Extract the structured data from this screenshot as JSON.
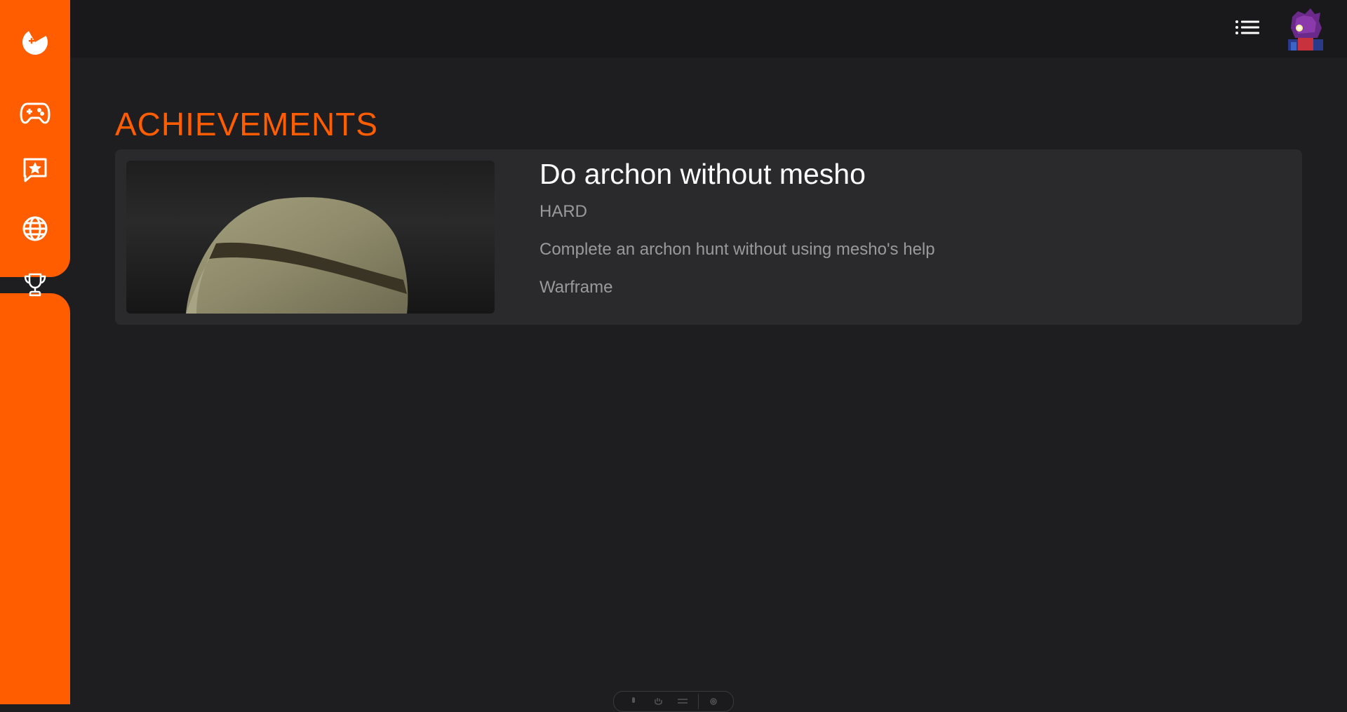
{
  "colors": {
    "accent": "#ff5d00",
    "background": "#1e1e20",
    "topbar": "#19191b",
    "card": "#2a2a2c",
    "muted_text": "#9a9a9a"
  },
  "sidebar": {
    "items": [
      {
        "name": "logo",
        "icon": "pacman-gamepad-icon"
      },
      {
        "name": "games",
        "icon": "gamepad-icon"
      },
      {
        "name": "reviews",
        "icon": "star-message-icon"
      },
      {
        "name": "community",
        "icon": "globe-icon"
      },
      {
        "name": "achievements",
        "icon": "trophy-icon",
        "active": true
      }
    ]
  },
  "topbar": {
    "menu_icon": "list-icon",
    "avatar_icon": "user-avatar"
  },
  "page": {
    "title": "ACHIEVEMENTS"
  },
  "achievements": [
    {
      "title": "Do archon without mesho",
      "difficulty": "HARD",
      "description": "Complete an archon hunt without using mesho's help",
      "game": "Warframe",
      "image": "helmet-thumbnail"
    }
  ],
  "dock": {
    "icons": [
      "microphone-icon",
      "hand-icon",
      "menu-lines-icon",
      "gear-icon"
    ]
  }
}
